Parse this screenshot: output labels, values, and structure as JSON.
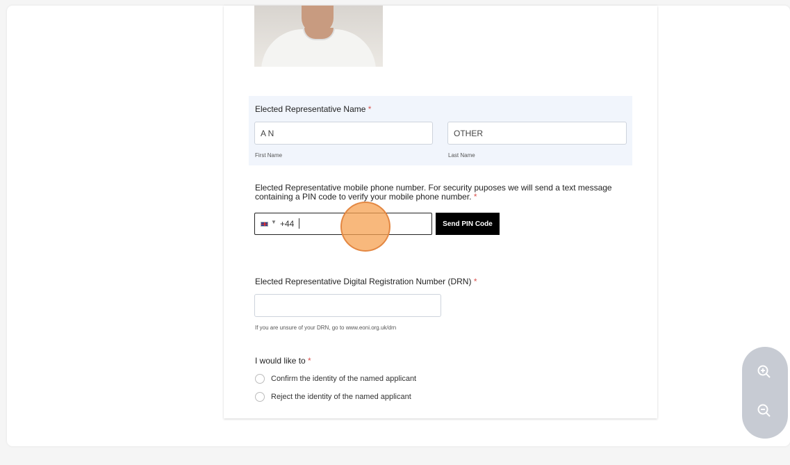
{
  "name_section": {
    "label": "Elected Representative Name",
    "required_mark": "*",
    "first_value": "A N",
    "first_sub": "First Name",
    "last_value": "OTHER",
    "last_sub": "Last Name"
  },
  "phone_section": {
    "label": "Elected Representative mobile phone number. For security puposes we will send a text message containing a PIN code to verify your mobile phone number.",
    "required_mark": "*",
    "dial_code": "+44",
    "send_button": "Send PIN Code"
  },
  "drn_section": {
    "label": "Elected Representative Digital Registration Number (DRN)",
    "required_mark": "*",
    "value": "",
    "help": "If you are unsure of your DRN, go to www.eoni.org.uk/drn"
  },
  "choice_section": {
    "label": "I would like to",
    "required_mark": "*",
    "options": [
      "Confirm the identity of the named applicant",
      "Reject the identity of the named applicant"
    ]
  },
  "icons": {
    "zoom_in": "zoom-in-icon",
    "zoom_out": "zoom-out-icon",
    "flag": "uk-flag-icon"
  }
}
